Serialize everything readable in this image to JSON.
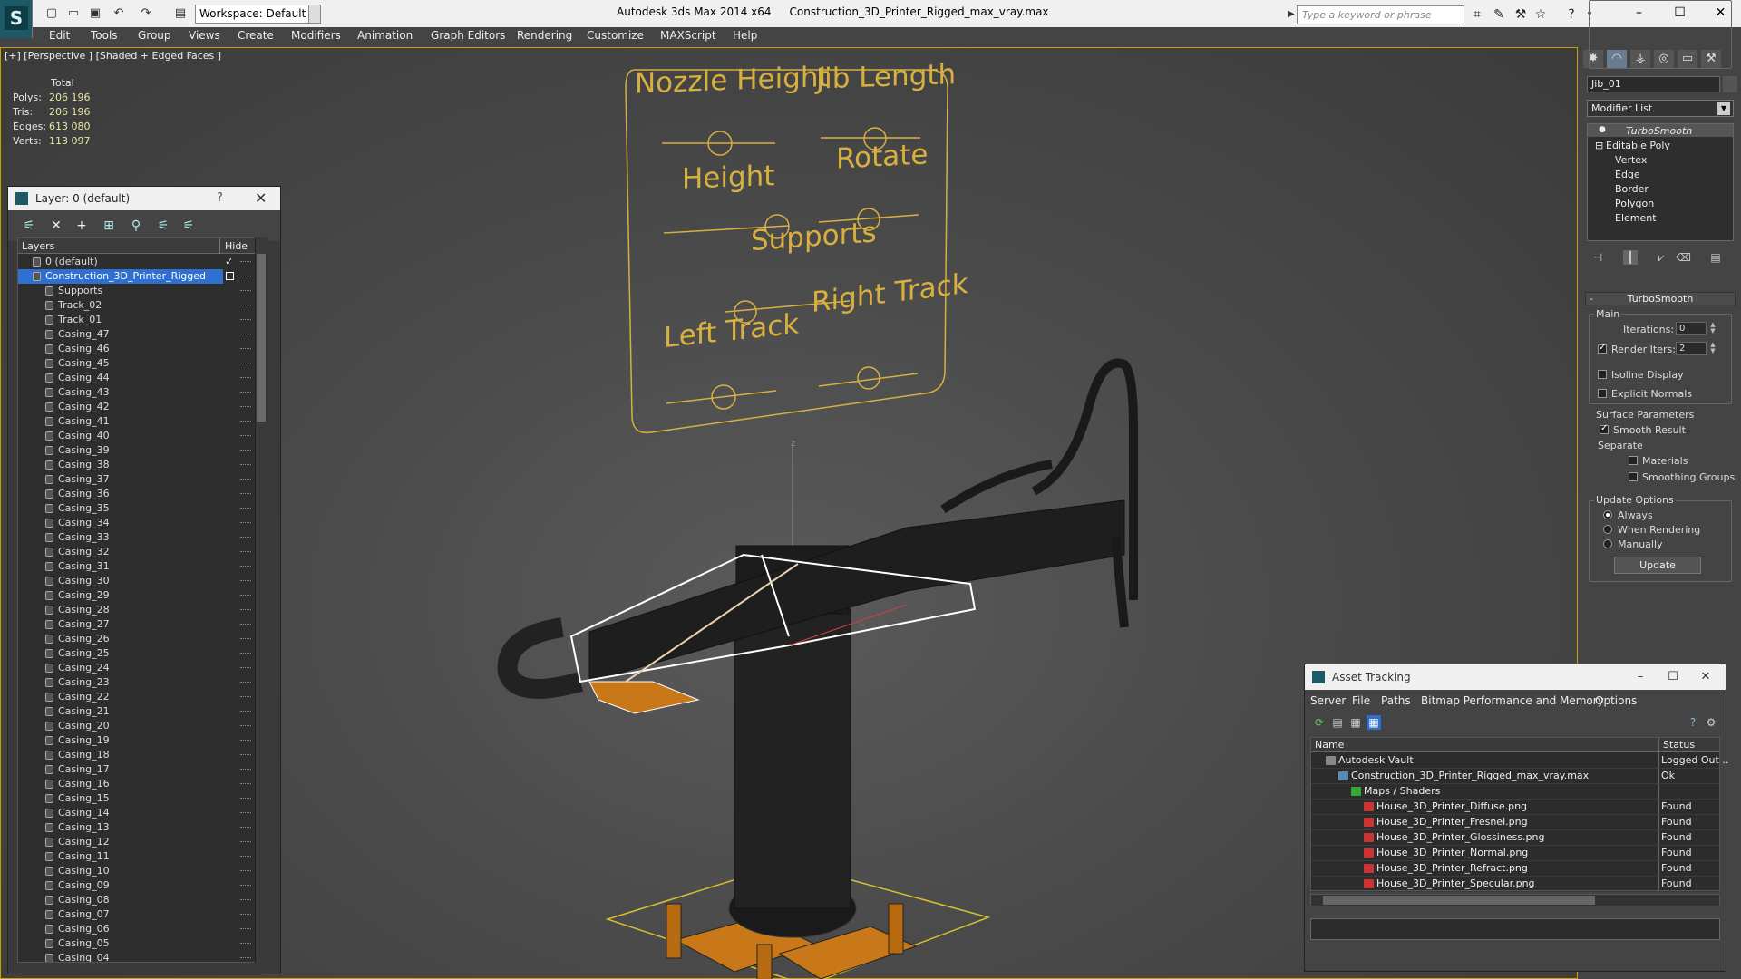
{
  "window": {
    "app_name": "Autodesk 3ds Max  2014 x64",
    "file_name": "Construction_3D_Printer_Rigged_max_vray.max",
    "workspace": "Workspace: Default",
    "search_placeholder": "Type a keyword or phrase"
  },
  "menu": [
    "Edit",
    "Tools",
    "Group",
    "Views",
    "Create",
    "Modifiers",
    "Animation",
    "Graph Editors",
    "Rendering",
    "Customize",
    "MAXScript",
    "Help"
  ],
  "viewport": {
    "label": "[+] [Perspective ] [Shaded + Edged Faces ]",
    "stats": {
      "header": "Total",
      "polys_label": "Polys:",
      "polys": "206 196",
      "tris_label": "Tris:",
      "tris": "206 196",
      "edges_label": "Edges:",
      "edges": "613 080",
      "verts_label": "Verts:",
      "verts": "113 097"
    },
    "rig_labels": {
      "nozzle_height": "Nozzle Height",
      "jib_length": "Jib Length",
      "height": "Height",
      "rotate": "Rotate",
      "supports": "Supports",
      "left_track": "Left Track",
      "right_track": "Right Track"
    },
    "axis_label": "z"
  },
  "layer_dialog": {
    "title": "Layer: 0 (default)",
    "help": "?",
    "col_layers": "Layers",
    "col_hide": "Hide",
    "layers": [
      {
        "name": "0 (default)",
        "level": 0
      },
      {
        "name": "Construction_3D_Printer_Rigged",
        "level": 0,
        "selected": true
      },
      {
        "name": "Supports",
        "level": 1
      },
      {
        "name": "Track_02",
        "level": 1
      },
      {
        "name": "Track_01",
        "level": 1
      },
      {
        "name": "Casing_47",
        "level": 1
      },
      {
        "name": "Casing_46",
        "level": 1
      },
      {
        "name": "Casing_45",
        "level": 1
      },
      {
        "name": "Casing_44",
        "level": 1
      },
      {
        "name": "Casing_43",
        "level": 1
      },
      {
        "name": "Casing_42",
        "level": 1
      },
      {
        "name": "Casing_41",
        "level": 1
      },
      {
        "name": "Casing_40",
        "level": 1
      },
      {
        "name": "Casing_39",
        "level": 1
      },
      {
        "name": "Casing_38",
        "level": 1
      },
      {
        "name": "Casing_37",
        "level": 1
      },
      {
        "name": "Casing_36",
        "level": 1
      },
      {
        "name": "Casing_35",
        "level": 1
      },
      {
        "name": "Casing_34",
        "level": 1
      },
      {
        "name": "Casing_33",
        "level": 1
      },
      {
        "name": "Casing_32",
        "level": 1
      },
      {
        "name": "Casing_31",
        "level": 1
      },
      {
        "name": "Casing_30",
        "level": 1
      },
      {
        "name": "Casing_29",
        "level": 1
      },
      {
        "name": "Casing_28",
        "level": 1
      },
      {
        "name": "Casing_27",
        "level": 1
      },
      {
        "name": "Casing_26",
        "level": 1
      },
      {
        "name": "Casing_25",
        "level": 1
      },
      {
        "name": "Casing_24",
        "level": 1
      },
      {
        "name": "Casing_23",
        "level": 1
      },
      {
        "name": "Casing_22",
        "level": 1
      },
      {
        "name": "Casing_21",
        "level": 1
      },
      {
        "name": "Casing_20",
        "level": 1
      },
      {
        "name": "Casing_19",
        "level": 1
      },
      {
        "name": "Casing_18",
        "level": 1
      },
      {
        "name": "Casing_17",
        "level": 1
      },
      {
        "name": "Casing_16",
        "level": 1
      },
      {
        "name": "Casing_15",
        "level": 1
      },
      {
        "name": "Casing_14",
        "level": 1
      },
      {
        "name": "Casing_13",
        "level": 1
      },
      {
        "name": "Casing_12",
        "level": 1
      },
      {
        "name": "Casing_11",
        "level": 1
      },
      {
        "name": "Casing_10",
        "level": 1
      },
      {
        "name": "Casing_09",
        "level": 1
      },
      {
        "name": "Casing_08",
        "level": 1
      },
      {
        "name": "Casing_07",
        "level": 1
      },
      {
        "name": "Casing_06",
        "level": 1
      },
      {
        "name": "Casing_05",
        "level": 1
      },
      {
        "name": "Casing_04",
        "level": 1
      }
    ]
  },
  "command_panel": {
    "object_name": "Jib_01",
    "modifier_list": "Modifier List",
    "stack": [
      "TurboSmooth",
      "Editable Poly",
      "Vertex",
      "Edge",
      "Border",
      "Polygon",
      "Element"
    ],
    "turbosmooth": {
      "title": "TurboSmooth",
      "main": "Main",
      "iterations_label": "Iterations:",
      "iterations": "0",
      "render_iters_label": "Render Iters:",
      "render_iters": "2",
      "render_iters_checked": true,
      "isoline": "Isoline Display",
      "explicit_normals": "Explicit Normals",
      "surface_params": "Surface Parameters",
      "smooth_result": "Smooth Result",
      "separate": "Separate",
      "materials": "Materials",
      "smoothing_groups": "Smoothing Groups",
      "update_options": "Update Options",
      "always": "Always",
      "when_rendering": "When Rendering",
      "manually": "Manually",
      "update_button": "Update"
    }
  },
  "asset_tracking": {
    "title": "Asset Tracking",
    "menu": [
      "Server",
      "File",
      "Paths",
      "Bitmap Performance and Memory",
      "Options"
    ],
    "col_name": "Name",
    "col_status": "Status",
    "rows": [
      {
        "name": "Autodesk Vault",
        "status": "Logged Out ..",
        "indent": 0,
        "icon": "vault"
      },
      {
        "name": "Construction_3D_Printer_Rigged_max_vray.max",
        "status": "Ok",
        "indent": 1,
        "icon": "max"
      },
      {
        "name": "Maps / Shaders",
        "status": "",
        "indent": 2,
        "icon": "folder"
      },
      {
        "name": "House_3D_Printer_Diffuse.png",
        "status": "Found",
        "indent": 3,
        "icon": "png"
      },
      {
        "name": "House_3D_Printer_Fresnel.png",
        "status": "Found",
        "indent": 3,
        "icon": "png"
      },
      {
        "name": "House_3D_Printer_Glossiness.png",
        "status": "Found",
        "indent": 3,
        "icon": "png"
      },
      {
        "name": "House_3D_Printer_Normal.png",
        "status": "Found",
        "indent": 3,
        "icon": "png"
      },
      {
        "name": "House_3D_Printer_Refract.png",
        "status": "Found",
        "indent": 3,
        "icon": "png"
      },
      {
        "name": "House_3D_Printer_Specular.png",
        "status": "Found",
        "indent": 3,
        "icon": "png"
      }
    ]
  },
  "colors": {
    "accent_select": "#2f6fd0",
    "rig_outline": "#d8b040",
    "viewport_border": "#c8a000"
  }
}
